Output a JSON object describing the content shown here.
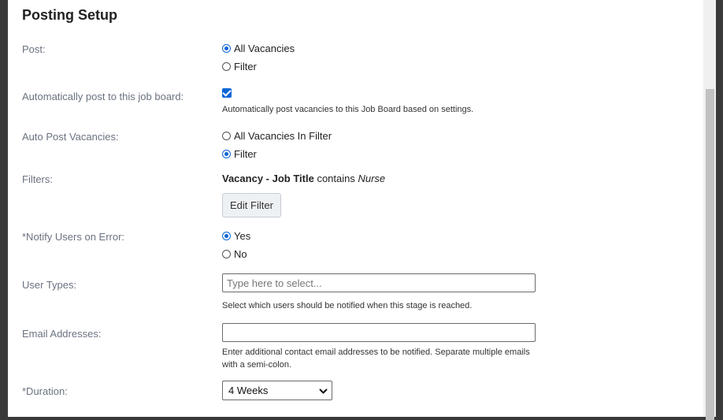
{
  "title": "Posting Setup",
  "post": {
    "label": "Post:",
    "options": [
      "All Vacancies",
      "Filter"
    ],
    "selected": "All Vacancies"
  },
  "auto_post_board": {
    "label": "Automatically post to this job board:",
    "checked": true,
    "help": "Automatically post vacancies to this Job Board based on settings."
  },
  "auto_post_vacancies": {
    "label": "Auto Post Vacancies:",
    "options": [
      "All Vacancies In Filter",
      "Filter"
    ],
    "selected": "Filter"
  },
  "filters": {
    "label": "Filters:",
    "field": "Vacancy - Job Title",
    "operator": "contains",
    "value": "Nurse",
    "edit_button": "Edit Filter"
  },
  "notify": {
    "label": "*Notify Users on Error:",
    "options": [
      "Yes",
      "No"
    ],
    "selected": "Yes"
  },
  "user_types": {
    "label": "User Types:",
    "placeholder": "Type here to select...",
    "help": "Select which users should be notified when this stage is reached."
  },
  "email": {
    "label": "Email Addresses:",
    "value": "",
    "help": "Enter additional contact email addresses to be notified. Separate multiple emails with a semi-colon."
  },
  "duration": {
    "label": "*Duration:",
    "selected": "4 Weeks"
  },
  "colors": {
    "accent": "#0a66d6",
    "label": "#6b7280"
  }
}
